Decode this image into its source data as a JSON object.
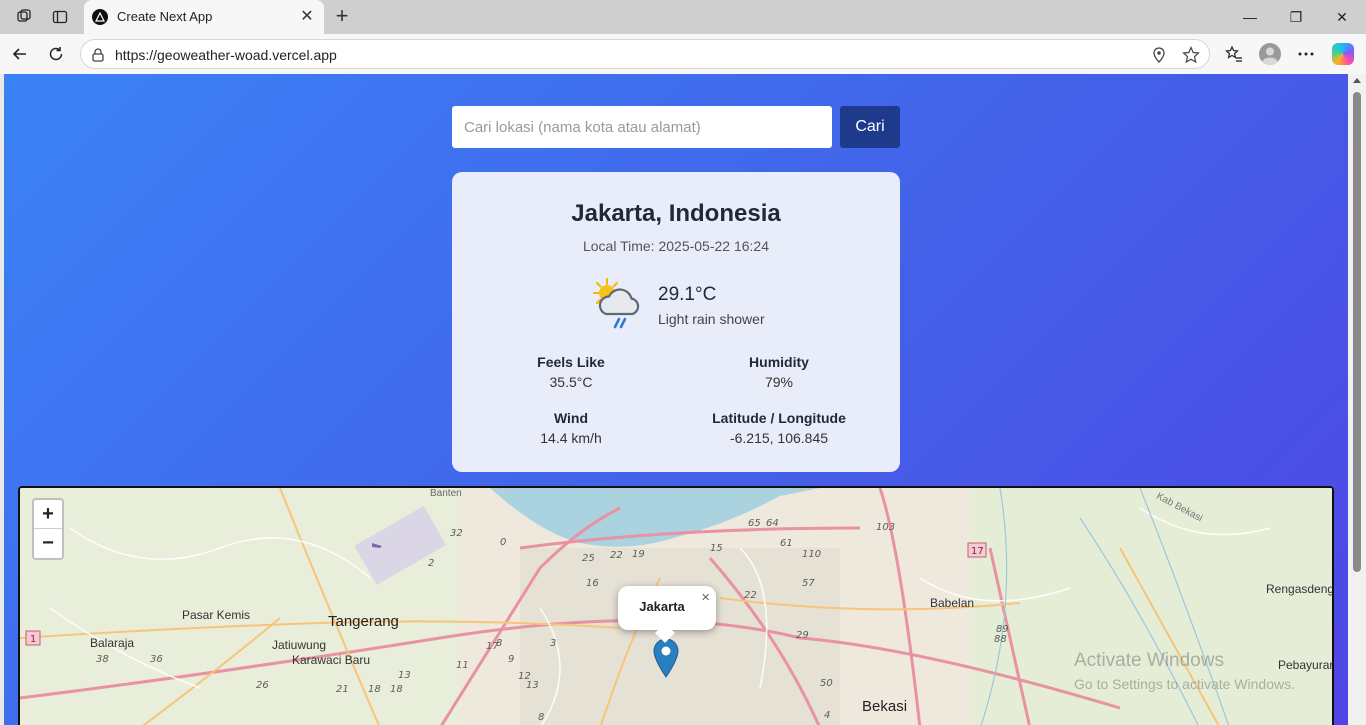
{
  "browser": {
    "tab_title": "Create Next App",
    "url": "https://geoweather-woad.vercel.app"
  },
  "search": {
    "placeholder": "Cari lokasi (nama kota atau alamat)",
    "button_label": "Cari"
  },
  "weather": {
    "location": "Jakarta, Indonesia",
    "local_time": "Local Time: 2025-05-22 16:24",
    "temperature": "29.1°C",
    "condition": "Light rain shower",
    "icon": "partly-cloudy-rain-icon",
    "stats": [
      {
        "label": "Feels Like",
        "value": "35.5°C"
      },
      {
        "label": "Humidity",
        "value": "79%"
      },
      {
        "label": "Wind",
        "value": "14.4 km/h"
      },
      {
        "label": "Latitude / Longitude",
        "value": "-6.215, 106.845"
      }
    ]
  },
  "map": {
    "zoom_in": "+",
    "zoom_out": "−",
    "popup_label": "Jakarta",
    "popup_close": "×",
    "place_labels": [
      "Tangerang",
      "Bekasi",
      "Babelan",
      "Pasar Kemis",
      "Balaraja",
      "Jatiuwung",
      "Karawaci Baru",
      "Rengasdengklok",
      "Pebayuran",
      "Banten",
      "Kab Bekasi"
    ],
    "watermark_line1": "Activate Windows",
    "watermark_line2": "Go to Settings to activate Windows."
  },
  "colors": {
    "bg_gradient_start": "#3b82f6",
    "bg_gradient_end": "#4f46e5",
    "button": "#1e3a8a",
    "card": "#e8edf9",
    "marker": "#2a7fc1"
  }
}
